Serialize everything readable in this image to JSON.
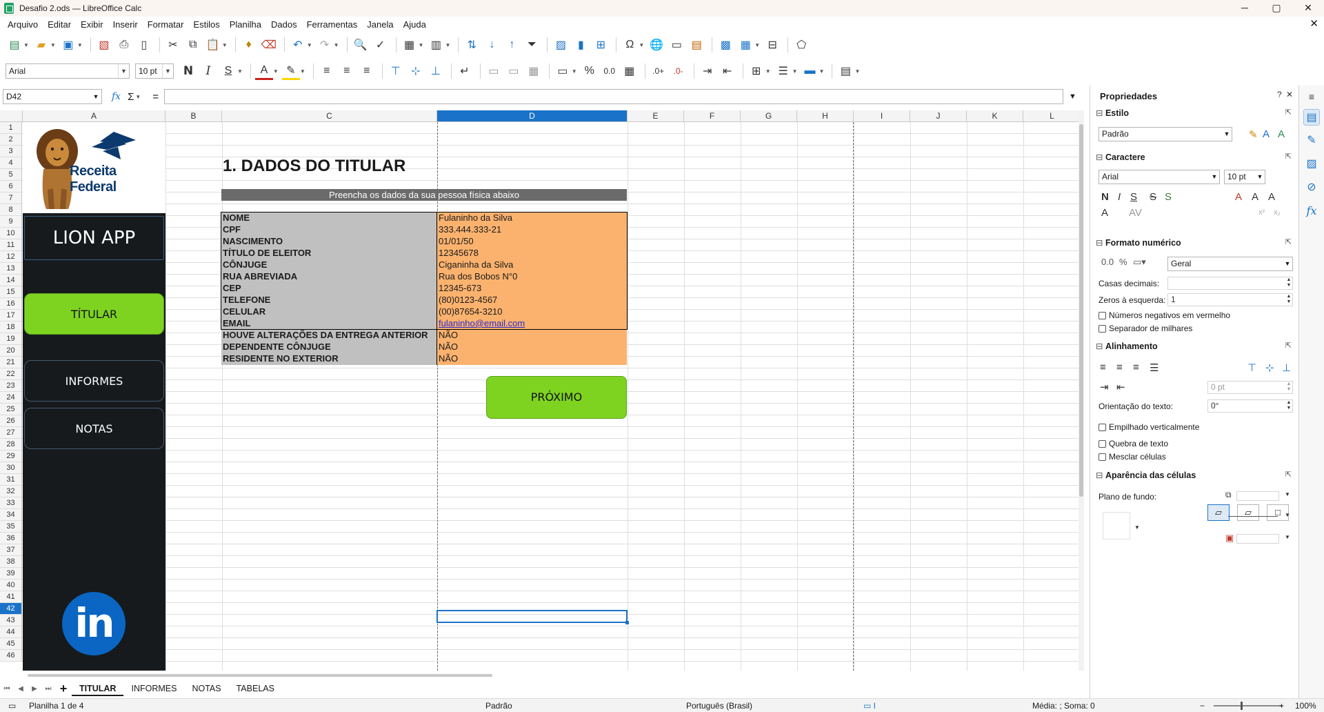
{
  "window": {
    "title": "Desafio 2.ods — LibreOffice Calc",
    "minimize": "─",
    "maximize": "▢",
    "close": "✕"
  },
  "menu": [
    "Arquivo",
    "Editar",
    "Exibir",
    "Inserir",
    "Formatar",
    "Estilos",
    "Planilha",
    "Dados",
    "Ferramentas",
    "Janela",
    "Ajuda"
  ],
  "toolbar": {
    "font_name": "Arial",
    "font_size": "10 pt",
    "bold": "N",
    "italic": "I",
    "underline": "S",
    "percent": "%",
    "decimal_format": "0.0"
  },
  "formula_bar": {
    "cell_ref": "D42",
    "fx": "fx",
    "sigma": "Σ",
    "equals": "=",
    "content": ""
  },
  "columns": [
    "A",
    "B",
    "C",
    "D",
    "E",
    "F",
    "G",
    "H",
    "I",
    "J",
    "K",
    "L"
  ],
  "selected_column": "D",
  "rows": [
    "1",
    "2",
    "3",
    "4",
    "5",
    "6",
    "7",
    "8",
    "9",
    "10",
    "11",
    "12",
    "13",
    "14",
    "15",
    "16",
    "17",
    "18",
    "19",
    "20",
    "21",
    "22",
    "23",
    "24",
    "25",
    "26",
    "27",
    "28",
    "29",
    "30",
    "31",
    "32",
    "33",
    "34",
    "35",
    "36",
    "37",
    "38",
    "39",
    "40",
    "41",
    "42",
    "43",
    "44",
    "45",
    "46"
  ],
  "selected_row": "42",
  "left_panel": {
    "logo_text": "Receita Federal",
    "app_title": "LION APP",
    "nav": {
      "titular": "TÍTULAR",
      "informes": "INFORMES",
      "notas": "NOTAS"
    },
    "linkedin": "in"
  },
  "content": {
    "heading": "1. DADOS DO TITULAR",
    "subheader": "Preencha os dados da sua pessoa física abaixo",
    "fields": [
      {
        "label": "NOME",
        "value": "Fulaninho da Silva"
      },
      {
        "label": "CPF",
        "value": "333.444.333-21"
      },
      {
        "label": "NASCIMENTO",
        "value": "01/01/50"
      },
      {
        "label": "TÍTULO DE ELEITOR",
        "value": "12345678"
      },
      {
        "label": "CÔNJUGE",
        "value": "Ciganinha da Silva"
      },
      {
        "label": "RUA ABREVIADA",
        "value": "Rua dos Bobos N°0"
      },
      {
        "label": "CEP",
        "value": "12345-673"
      },
      {
        "label": "TELEFONE",
        "value": "(80)0123-4567"
      },
      {
        "label": "CELULAR",
        "value": "(00)87654-3210"
      },
      {
        "label": "EMAIL",
        "value": "fulaninho@email.com"
      },
      {
        "label": "HOUVE ALTERAÇÕES DA ENTREGA ANTERIOR",
        "value": "NÃO"
      },
      {
        "label": "DEPENDENTE CÔNJUGE",
        "value": "NÃO"
      },
      {
        "label": "RESIDENTE NO EXTERIOR",
        "value": "NÃO"
      }
    ],
    "next_button": "PRÓXIMO"
  },
  "sidebar": {
    "title": "Propriedades",
    "help": "?",
    "close": "✕",
    "menu": "≡",
    "sections": {
      "estilo": "Estilo",
      "caractere": "Caractere",
      "formato_numerico": "Formato numérico",
      "alinhamento": "Alinhamento",
      "aparencia": "Aparência das células"
    },
    "style_value": "Padrão",
    "font_name": "Arial",
    "font_size": "10 pt",
    "number_format": "Geral",
    "casas_decimais_label": "Casas decimais:",
    "casas_decimais_value": "",
    "zeros_label": "Zeros à esquerda:",
    "zeros_value": "1",
    "neg_red": "Números negativos em vermelho",
    "thousands_sep": "Separador de milhares",
    "indent_value": "0 pt",
    "orientation_label": "Orientação do texto:",
    "orientation_value": "0°",
    "stacked": "Empilhado verticalmente",
    "wrap": "Quebra de texto",
    "merge": "Mesclar células",
    "background_label": "Plano de fundo:"
  },
  "sheet_tabs": [
    "TITULAR",
    "INFORMES",
    "NOTAS",
    "TABELAS"
  ],
  "active_tab": "TITULAR",
  "status": {
    "sheet": "Planilha 1 de 4",
    "style": "Padrão",
    "language": "Português (Brasil)",
    "summary": "Média: ; Soma: 0",
    "zoom": "100%"
  }
}
